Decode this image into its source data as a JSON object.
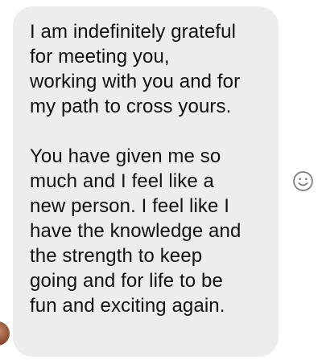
{
  "message": {
    "paragraphs": [
      {
        "lines": [
          "I am indefinitely grateful",
          "for meeting you,",
          "working with you and for",
          "my path to cross yours."
        ]
      },
      {
        "lines": [
          "You have given me so",
          "much and I feel like a",
          "new person. I feel like I",
          "have the knowledge and",
          "the strength to keep",
          "going and for life to be",
          "fun and exciting again."
        ]
      }
    ]
  },
  "icons": {
    "reaction": "smiley-face-icon",
    "sender": "avatar"
  },
  "colors": {
    "bubble_background": "#ededed",
    "text": "#111111",
    "icon": "#7a7a7a"
  }
}
